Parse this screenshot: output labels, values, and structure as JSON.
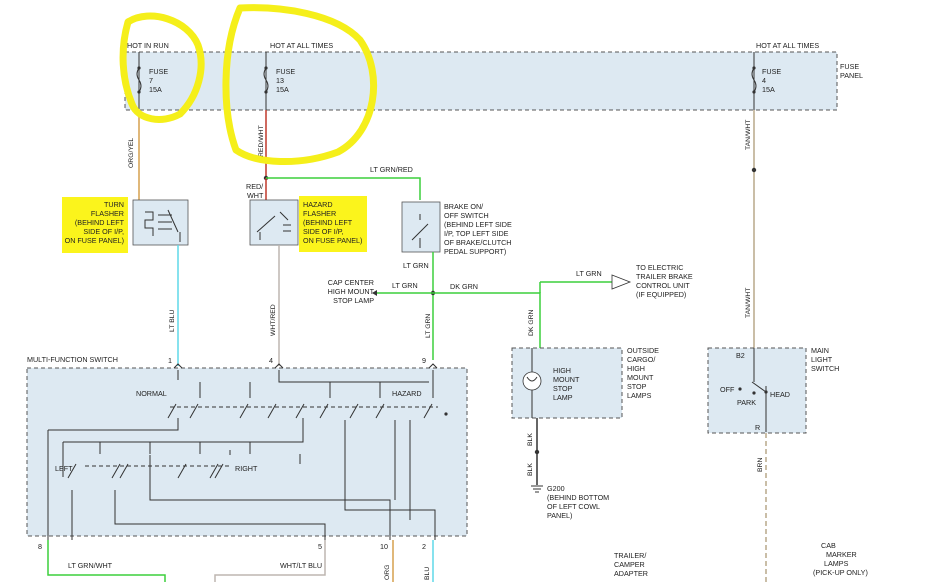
{
  "fuse_panel": {
    "label": [
      "FUSE",
      "PANEL"
    ],
    "sources": [
      {
        "header": "HOT IN RUN",
        "fuse": [
          "FUSE",
          "7",
          "15A"
        ]
      },
      {
        "header": "HOT AT ALL TIMES",
        "fuse": [
          "FUSE",
          "13",
          "15A"
        ]
      },
      {
        "header": "HOT AT ALL TIMES",
        "fuse": [
          "FUSE",
          "4",
          "15A"
        ]
      }
    ]
  },
  "wires": {
    "org_yel": "ORG/YEL",
    "red_wht": "RED/WHT",
    "red_wht_split": [
      "RED/",
      "WHT"
    ],
    "tan_wht_top": "TAN/WHT",
    "tan_wht_bottom": "TAN/WHT",
    "lt_grn_red": "LT GRN/RED",
    "lt_grn_1": "LT GRN",
    "lt_grn_2": "LT GRN",
    "lt_grn_3": "LT GRN",
    "lt_grn_trailer": "LT GRN",
    "dk_grn_h": "DK GRN",
    "dk_grn_v": "DK GRN",
    "lt_blu": "LT BLU",
    "wht_red": "WHT/RED",
    "blk_1": "BLK",
    "blk_2": "BLK",
    "brn": "BRN",
    "lt_grn_wht": "LT GRN/WHT",
    "wht_lt_blu": "WHT/LT BLU",
    "org": "ORG",
    "blu": "BLU"
  },
  "components": {
    "turn_flasher": [
      "TURN",
      "FLASHER",
      "(BEHIND LEFT",
      "SIDE OF I/P,",
      "ON FUSE PANEL)"
    ],
    "hazard_flasher": [
      "HAZARD",
      "FLASHER",
      "(BEHIND LEFT",
      "SIDE OF I/P,",
      "ON FUSE PANEL)"
    ],
    "brake_switch": [
      "BRAKE ON/",
      "OFF SWITCH",
      "(BEHIND LEFT SIDE",
      "I/P, TOP LEFT SIDE",
      "OF BRAKE/CLUTCH",
      "PEDAL SUPPORT)"
    ],
    "cap_center": [
      "CAP CENTER",
      "HIGH MOUNT",
      "STOP LAMP"
    ],
    "trailer_brake": [
      "TO ELECTRIC",
      "TRAILER BRAKE",
      "CONTROL UNIT",
      "(IF EQUIPPED)"
    ],
    "outside_cargo": [
      "OUTSIDE",
      "CARGO/",
      "HIGH",
      "MOUNT",
      "STOP",
      "LAMPS"
    ],
    "high_mount_lamp": [
      "HIGH",
      "MOUNT",
      "STOP",
      "LAMP"
    ],
    "ground": [
      "G200",
      "(BEHIND BOTTOM",
      "OF LEFT COWL",
      "PANEL)"
    ],
    "main_light_switch": [
      "MAIN",
      "LIGHT",
      "SWITCH"
    ],
    "mls_positions": {
      "b2": "B2",
      "off": "OFF",
      "park": "PARK",
      "head": "HEAD",
      "r": "R"
    },
    "multi_function_switch": "MULTI-FUNCTION SWITCH",
    "mfs_positions": {
      "normal": "NORMAL",
      "hazard": "HAZARD",
      "left": "LEFT",
      "right": "RIGHT"
    },
    "trailer_adapter": [
      "TRAILER/",
      "CAMPER",
      "ADAPTER"
    ],
    "cab_marker": [
      "CAB",
      "MARKER",
      "LAMPS",
      "(PICK-UP ONLY)"
    ]
  },
  "pins": {
    "p1": "1",
    "p4": "4",
    "p9": "9",
    "p8": "8",
    "p5": "5",
    "p10": "10",
    "p2": "2"
  },
  "colors": {
    "highlight": "#fbf41c",
    "fuse_panel_fill": "#dde9f2",
    "wire_green": "#3ccf3c",
    "wire_lt_blue": "#5fd8e8",
    "wire_red": "#c0392b",
    "wire_tan": "#b9a98a",
    "wire_org_yel": "#d6a14d",
    "wire_gray": "#bdb6b0"
  }
}
